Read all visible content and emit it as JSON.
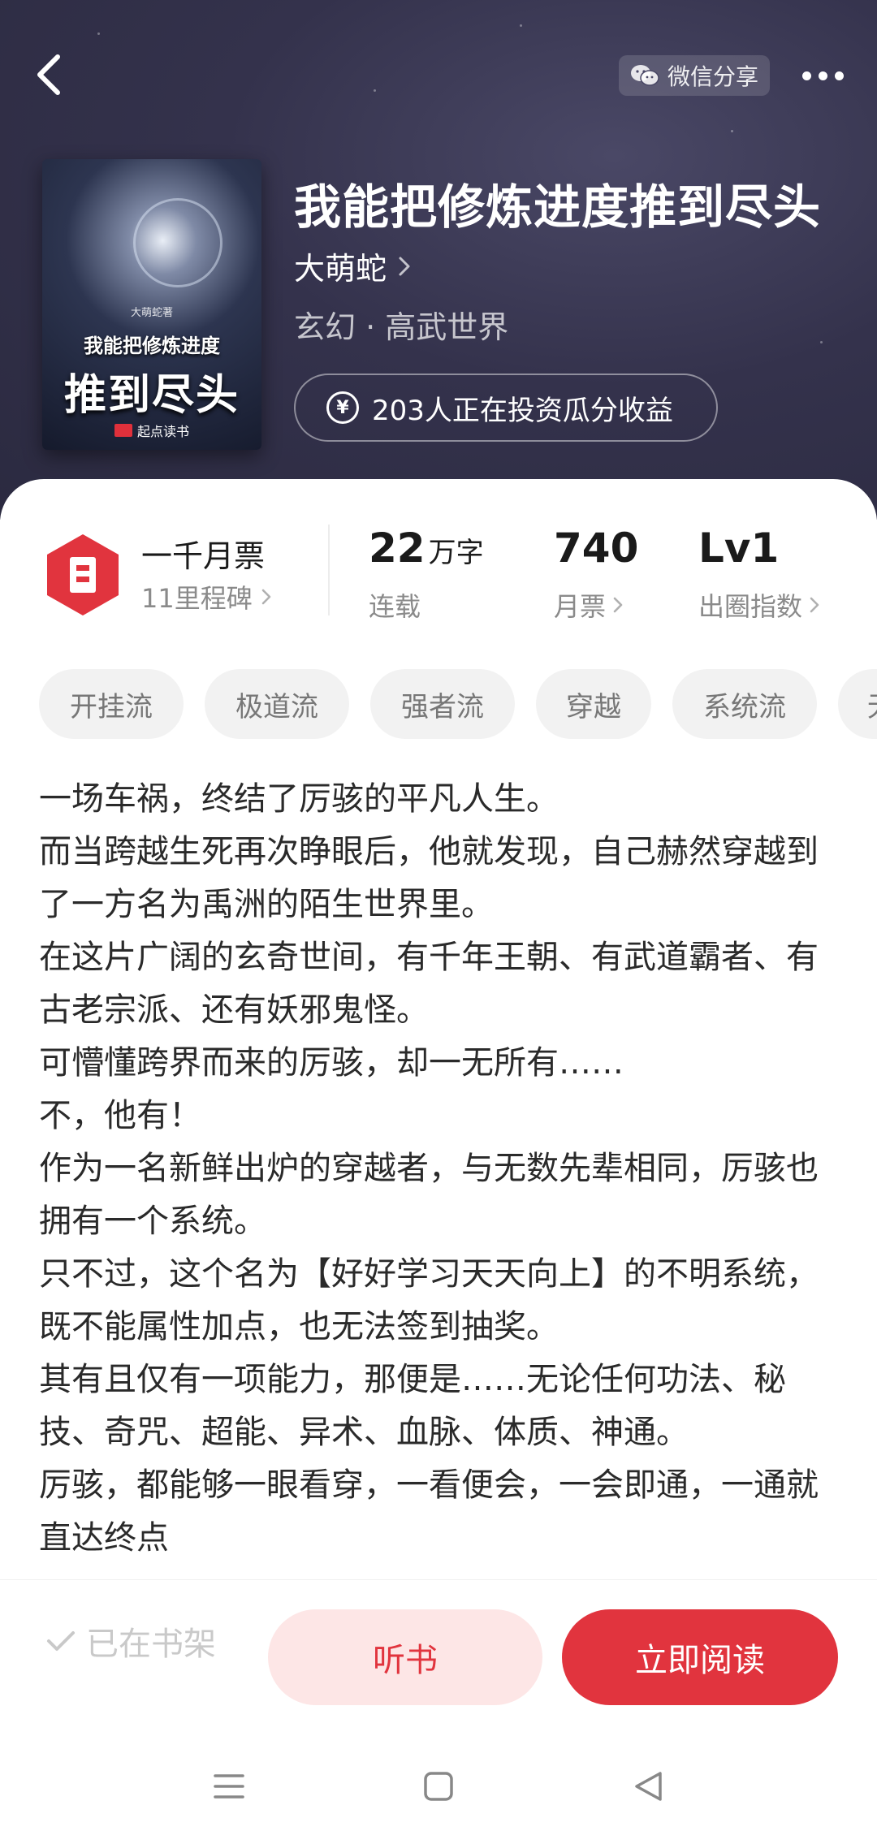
{
  "header": {
    "share_label": "微信分享",
    "book_title": "我能把修炼进度推到尽头",
    "author": "大萌蛇",
    "genre": "玄幻 · 高武世界",
    "invest_text": "203人正在投资瓜分收益",
    "icons": [
      "back-icon",
      "wechat-icon",
      "more-icon",
      "chevron-right-icon",
      "yen-icon"
    ]
  },
  "cover": {
    "small_text": "大萌蛇著",
    "title_line1": "我能把修炼进度",
    "title_line2": "推到尽头",
    "publisher": "起点读书"
  },
  "milestone": {
    "title": "一千月票",
    "subtitle": "11里程碑"
  },
  "stats": [
    {
      "value": "22",
      "unit": "万字",
      "label": "连载"
    },
    {
      "value": "740",
      "unit": "",
      "label": "月票"
    },
    {
      "value": "Lv1",
      "unit": "",
      "label": "出圈指数"
    }
  ],
  "tags": [
    "开挂流",
    "极道流",
    "强者流",
    "穿越",
    "系统流",
    "无"
  ],
  "synopsis": [
    "一场车祸，终结了厉骇的平凡人生。",
    "而当跨越生死再次睁眼后，他就发现，自己赫然穿越到了一方名为禹洲的陌生世界里。",
    "在这片广阔的玄奇世间，有千年王朝、有武道霸者、有古老宗派、还有妖邪鬼怪。",
    "可懵懂跨界而来的厉骇，却一无所有……",
    "不，他有！",
    "作为一名新鲜出炉的穿越者，与无数先辈相同，厉骇也拥有一个系统。",
    "只不过，这个名为【好好学习天天向上】的不明系统，既不能属性加点，也无法签到抽奖。",
    "其有且仅有一项能力，那便是……无论任何功法、秘技、奇咒、超能、异术、血脉、体质、神通。",
    "厉骇，都能够一眼看穿，一看便会，一会即通，一通就直达终点"
  ],
  "bottom": {
    "on_shelf": "已在书架",
    "listen": "听书",
    "read": "立即阅读"
  },
  "colors": {
    "accent": "#e1343e",
    "accent_light": "#fde6e6",
    "header_bg": "#34324c"
  }
}
